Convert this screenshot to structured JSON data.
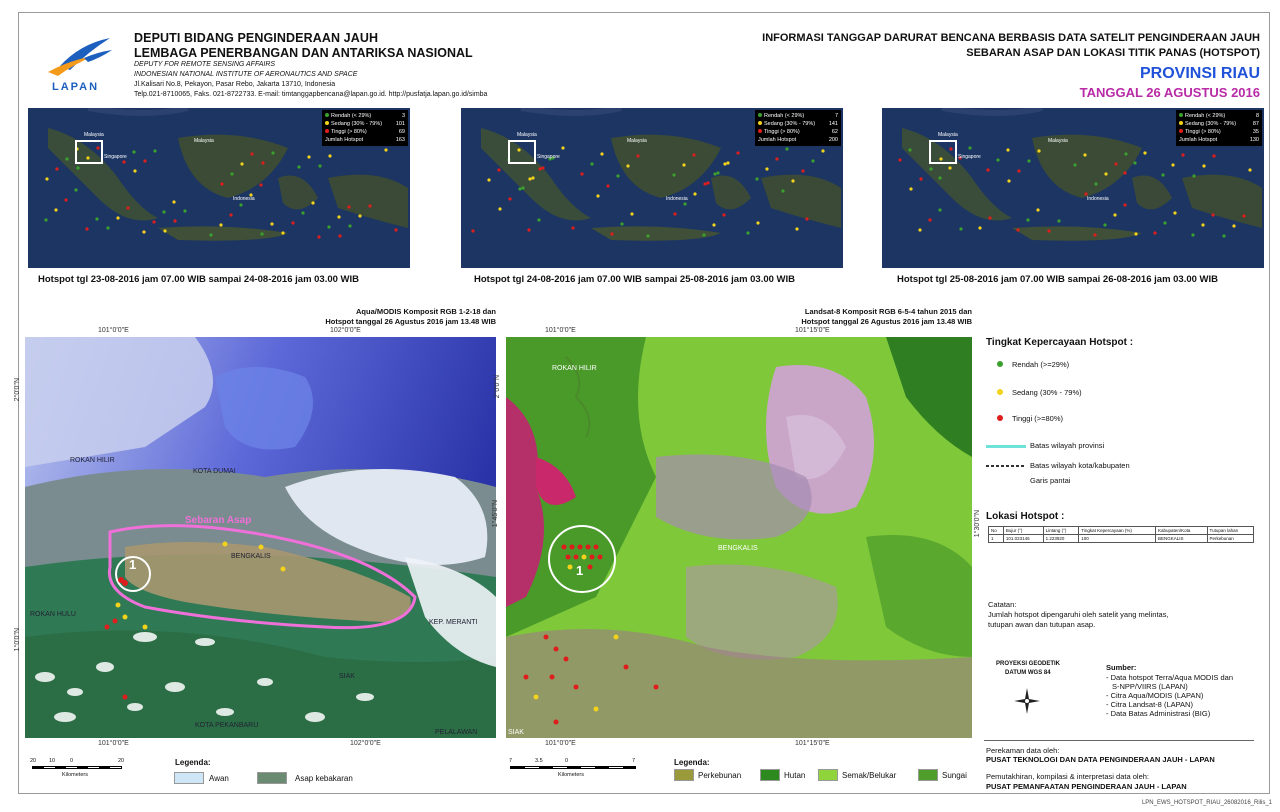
{
  "header": {
    "org_line1": "DEPUTI BIDANG PENGINDERAAN JAUH",
    "org_line2": "LEMBAGA PENERBANGAN DAN ANTARIKSA NASIONAL",
    "org_line3": "DEPUTY FOR REMOTE SENSING AFFAIRS",
    "org_line4": "INDONESIAN NATIONAL INSTITUTE OF AERONAUTICS AND SPACE",
    "org_line5": "Jl.Kalisari No.8, Pekayon, Pasar Rebo, Jakarta 13710, Indonesia",
    "org_line6": "Telp.021-8710065, Faks. 021-8722733. E-mail: timtanggapbencana@lapan.go.id. http://pusfatja.lapan.go.id/simba",
    "logo_text": "LAPAN",
    "title1": "INFORMASI TANGGAP DARURAT BENCANA BERBASIS DATA SATELIT PENGINDERAAN JAUH",
    "title2": "SEBARAN ASAP DAN LOKASI TITIK PANAS (HOTSPOT)",
    "province": "PROVINSI RIAU",
    "date": "TANGGAL 26 AGUSTUS 2016",
    "colors": {
      "province": "#1f52d8",
      "date": "#b82aa6"
    }
  },
  "small_maps": [
    {
      "caption": "Hotspot tgl 23-08-2016 jam 07.00 WIB sampai 24-08-2016 jam 03.00 WIB",
      "legend": [
        {
          "label": "Rendah",
          "range": "(< 29%)",
          "count": "3"
        },
        {
          "label": "Sedang",
          "range": "(30% - 79%)",
          "count": "101"
        },
        {
          "label": "Tinggi",
          "range": "(> 80%)",
          "count": "69"
        }
      ],
      "total_label": "Jumlah Hotspot",
      "total": "163"
    },
    {
      "caption": "Hotspot tgl 24-08-2016 jam 07.00 WIB sampai 25-08-2016 jam 03.00 WIB",
      "legend": [
        {
          "label": "Rendah",
          "range": "(< 29%)",
          "count": "7"
        },
        {
          "label": "Sedang",
          "range": "(30% - 79%)",
          "count": "141"
        },
        {
          "label": "Tinggi",
          "range": "(> 80%)",
          "count": "62"
        }
      ],
      "total_label": "Jumlah Hotspot",
      "total": "200"
    },
    {
      "caption": "Hotspot tgl 25-08-2016 jam 07.00 WIB sampai 26-08-2016 jam 03.00 WIB",
      "legend": [
        {
          "label": "Rendah",
          "range": "(< 29%)",
          "count": "8"
        },
        {
          "label": "Sedang",
          "range": "(30% - 79%)",
          "count": "87"
        },
        {
          "label": "Tinggi",
          "range": "(> 80%)",
          "count": "35"
        }
      ],
      "total_label": "Jumlah Hotspot",
      "total": "130"
    }
  ],
  "map_labels": {
    "malaysia": "Malaysia",
    "indonesia": "Indonesia",
    "singapore": "Singapore"
  },
  "left_map": {
    "caption1": "Aqua/MODIS Komposit RGB 1-2-18 dan",
    "caption2": "Hotspot tanggal 26 Agustus 2016 jam 13.48 WIB",
    "coord_top1": "101°0'0\"E",
    "coord_top2": "102°0'0\"E",
    "coord_bottom1": "101°0'0\"E",
    "coord_bottom2": "102°0'0\"E",
    "coord_left1": "2°0'0\"N",
    "coord_left2": "1°0'0\"N",
    "labels": {
      "rokan_hilir": "ROKAN HILIR",
      "kota_dumai": "KOTA DUMAI",
      "bengkalis": "BENGKALIS",
      "rokan_hulu": "ROKAN HULU",
      "kep_meranti": "KEP. MERANTI",
      "siak": "SIAK",
      "pelalawan": "PELALAWAN",
      "kota_pekanbaru": "KOTA PEKANBARU",
      "smoke": "Sebaran Asap",
      "circle_num": "1"
    }
  },
  "right_map": {
    "caption1": "Landsat-8 Komposit RGB 6-5-4 tahun 2015 dan",
    "caption2": "Hotspot tanggal 26 Agustus 2016  jam 13.48 WIB",
    "coord_top1": "101°0'0\"E",
    "coord_top2": "101°15'0\"E",
    "coord_bottom1": "101°0'0\"E",
    "coord_bottom2": "101°15'0\"E",
    "coord_left": "2°0'0\"N",
    "coord_right": "1°45'0\"N",
    "coord_right2": "1°30'0\"N",
    "labels": {
      "rokan_hilir": "ROKAN HILIR",
      "bengkalis": "BENGKALIS",
      "siak": "SIAK",
      "circle_num": "1"
    }
  },
  "side_panel": {
    "confidence_title": "Tingkat Kepercayaan Hotspot :",
    "confidence": [
      {
        "label": "Rendah (>=29%)",
        "color": "#3aa02e"
      },
      {
        "label": "Sedang (30% - 79%)",
        "color": "#f2d21b"
      },
      {
        "label": "Tinggi (>=80%)",
        "color": "#e01d1d"
      }
    ],
    "boundary1": "Batas wilayah provinsi",
    "boundary2": "Batas wilayah kota/kabupaten",
    "boundary3": "Garis pantai",
    "location_title": "Lokasi Hotspot :",
    "table_headers": [
      "No",
      "Bujur (°)",
      "Lintang (°)",
      "Tingkat Kepercayaan (%)",
      "Kabupaten/Kota",
      "Tutupan lahan"
    ],
    "table_rows": [
      [
        "1",
        "101.023146",
        "1.223920",
        "100",
        "BENGKALIS",
        "Perkebunan"
      ]
    ],
    "note_title": "Catatan:",
    "note1": "Jumlah hotspot dipengaruhi oleh satelit yang melintas,",
    "note2": "tutupan awan dan tutupan asap.",
    "projection1": "PROYEKSI GEODETIK",
    "projection2": "DATUM WGS 84",
    "source_title": "Sumber:",
    "sources": [
      "- Data hotspot Terra/Aqua MODIS dan",
      "  S-NPP/VIIRS (LAPAN)",
      "- Citra Aqua/MODIS (LAPAN)",
      "- Citra Landsat-8 (LAPAN)",
      "- Data Batas Administrasi (BIG)"
    ],
    "rec_title": "Perekaman data oleh:",
    "rec_org": "PUSAT TEKNOLOGI DAN DATA PENGINDERAAN JAUH - LAPAN",
    "proc_title": "Pemutakhiran, kompilasi & interpretasi data oleh:",
    "proc_org": "PUSAT PEMANFAATAN PENGINDERAAN JAUH - LAPAN"
  },
  "bottom_left": {
    "scale_ticks": [
      "20",
      "10",
      "0",
      "20"
    ],
    "scale_unit": "Kilometers",
    "legend_title": "Legenda:",
    "items": [
      {
        "label": "Awan",
        "color": "#cfe6f7"
      },
      {
        "label": "Asap kebakaran",
        "color": "#6b8a72"
      }
    ]
  },
  "bottom_right": {
    "scale_ticks": [
      "7",
      "3.5",
      "0",
      "7"
    ],
    "scale_unit": "Kilometers",
    "legend_title": "Legenda:",
    "items": [
      {
        "label": "Perkebunan",
        "color": "#9a9a3a"
      },
      {
        "label": "Hutan",
        "color": "#2d8a1e"
      },
      {
        "label": "Semak/Belukar",
        "color": "#8fd43a"
      },
      {
        "label": "Sungai",
        "color": "#4f9d2a"
      }
    ]
  },
  "corner_code": "LPN_EWS_HOTSPOT_RIAU_26082016_Rilis_1"
}
